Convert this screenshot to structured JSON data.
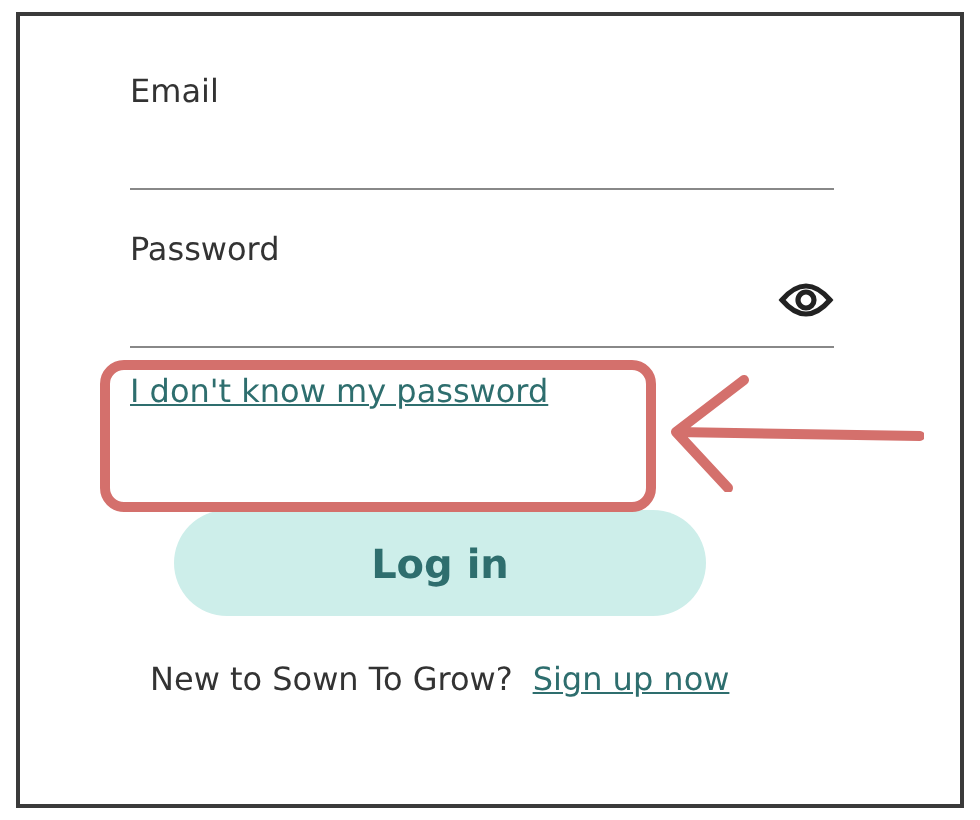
{
  "form": {
    "fields": [
      {
        "label": "Email",
        "kind": "text"
      },
      {
        "label": "Password",
        "kind": "password"
      }
    ],
    "forgot_link": "I don't know my password",
    "submit_button": "Log in",
    "signup": {
      "prompt": "New to Sown To Grow?",
      "link": "Sign up now"
    }
  }
}
